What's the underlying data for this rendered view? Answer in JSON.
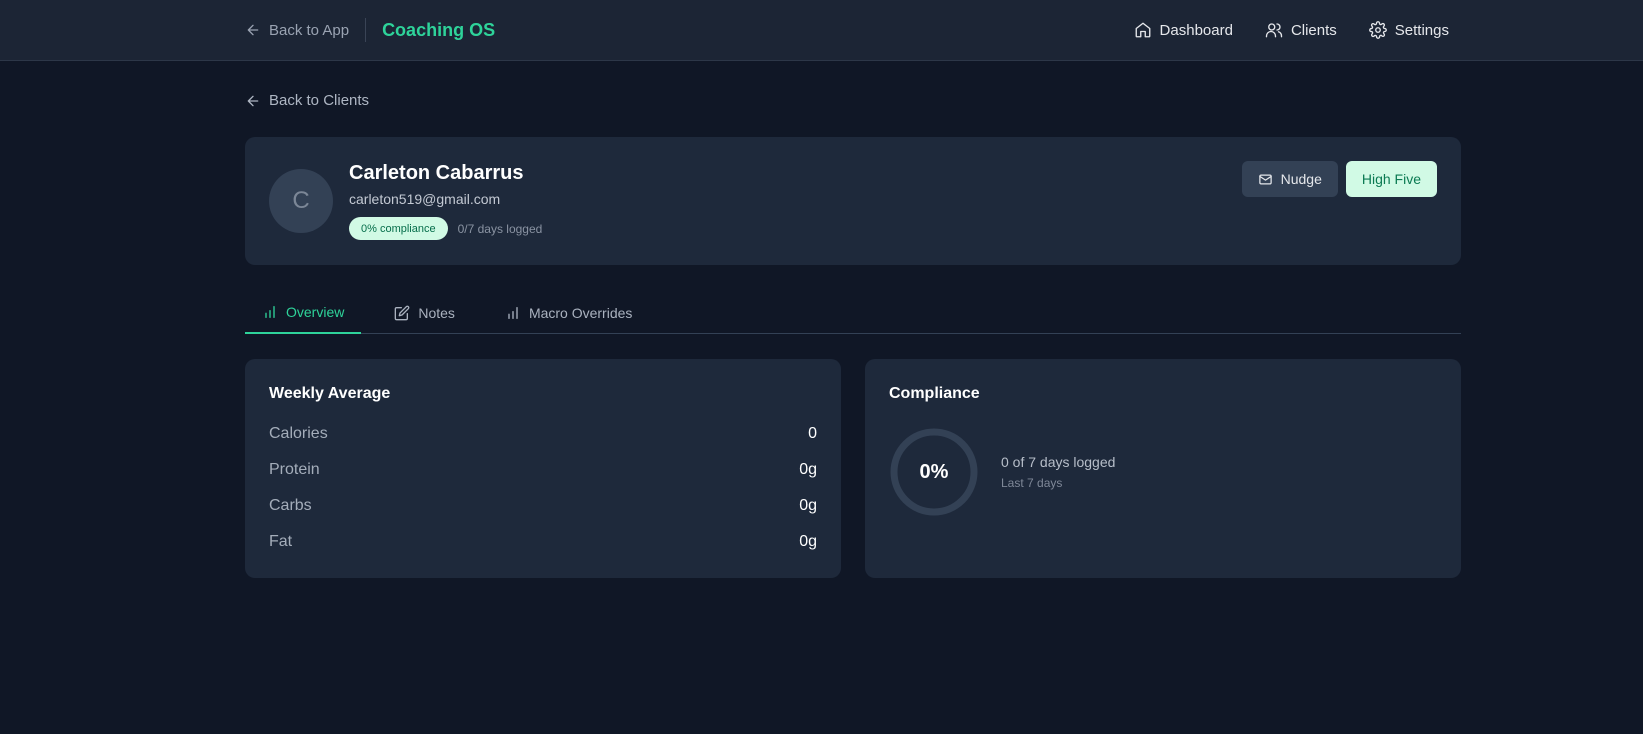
{
  "topbar": {
    "back_label": "Back to App",
    "brand": "Coaching OS",
    "nav": [
      {
        "label": "Dashboard",
        "icon": "home-icon"
      },
      {
        "label": "Clients",
        "icon": "users-icon"
      },
      {
        "label": "Settings",
        "icon": "gear-icon"
      }
    ]
  },
  "back_clients_label": "Back to Clients",
  "client": {
    "initial": "C",
    "name": "Carleton Cabarrus",
    "email": "carleton519@gmail.com",
    "compliance_badge": "0% compliance",
    "days_logged": "0/7 days logged",
    "actions": {
      "nudge": "Nudge",
      "high_five": "High Five"
    }
  },
  "tabs": [
    {
      "label": "Overview",
      "icon": "bar-chart-icon",
      "active": true
    },
    {
      "label": "Notes",
      "icon": "edit-icon",
      "active": false
    },
    {
      "label": "Macro Overrides",
      "icon": "bar-chart-icon",
      "active": false
    }
  ],
  "weekly_average": {
    "title": "Weekly Average",
    "rows": [
      {
        "label": "Calories",
        "value": "0"
      },
      {
        "label": "Protein",
        "value": "0g"
      },
      {
        "label": "Carbs",
        "value": "0g"
      },
      {
        "label": "Fat",
        "value": "0g"
      }
    ]
  },
  "compliance": {
    "title": "Compliance",
    "percent_label": "0%",
    "percent": 0,
    "summary": "0 of 7 days logged",
    "period": "Last 7 days"
  },
  "colors": {
    "accent": "#2ed39a",
    "background": "#101726",
    "card": "#1e293b",
    "badge_bg": "#d1fae5"
  }
}
